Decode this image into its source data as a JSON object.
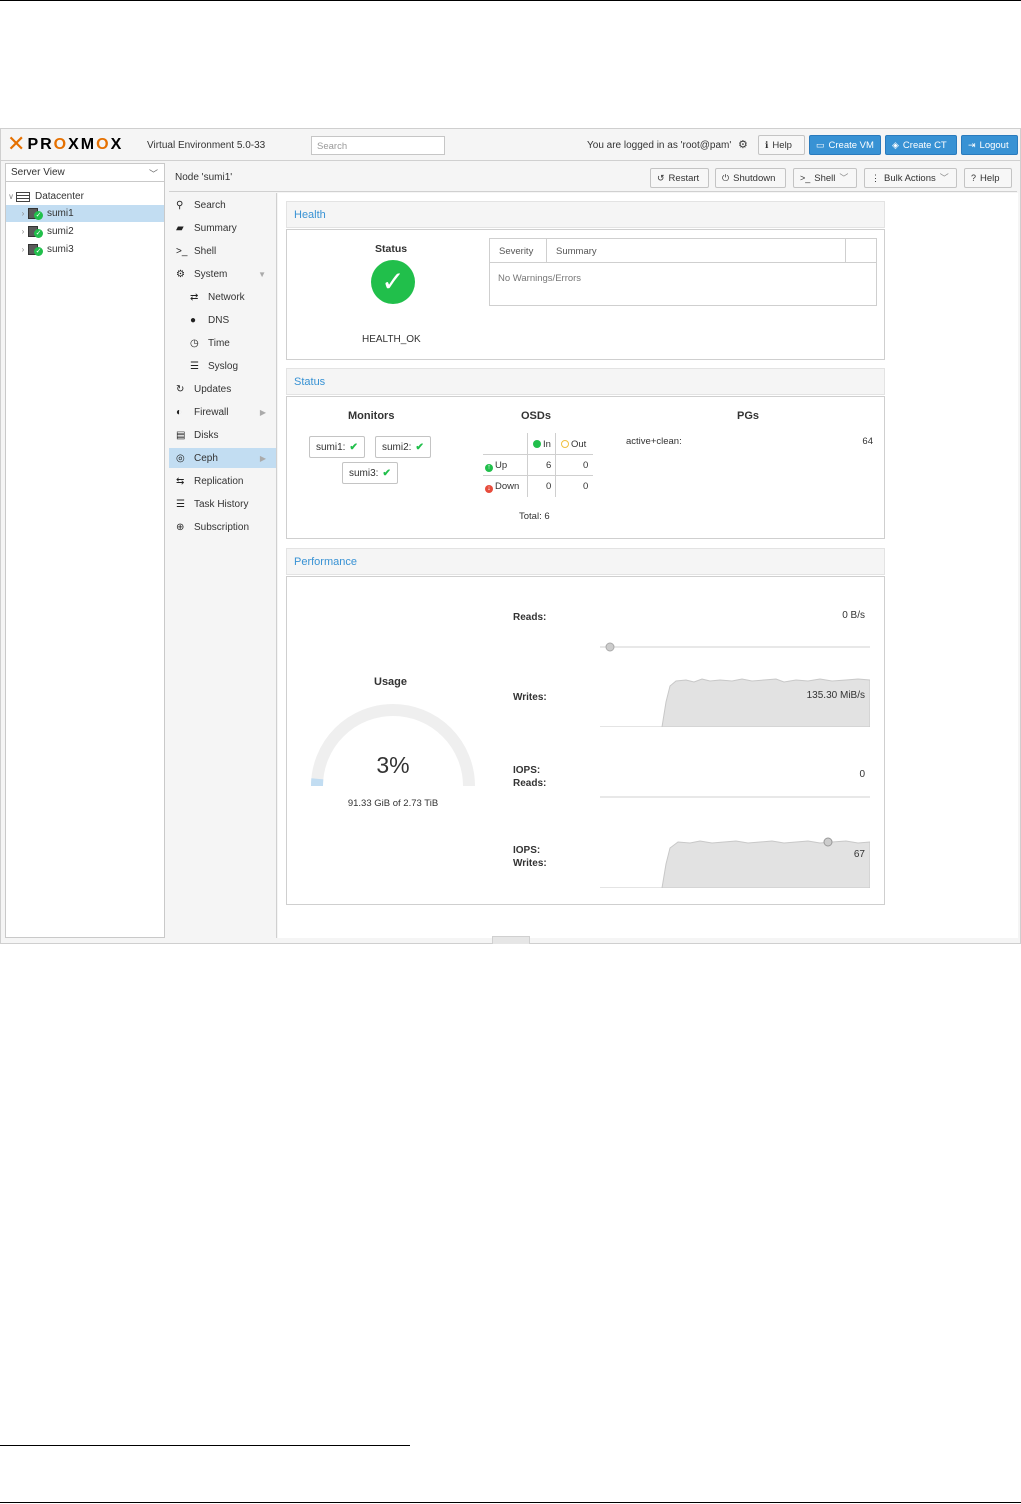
{
  "brand": {
    "logo_x": "✕",
    "logo_prefix": "PR",
    "logo_o1": "O",
    "logo_mid": "XM",
    "logo_o2": "O",
    "logo_suffix": "X",
    "version": "Virtual Environment 5.0-33",
    "accent": "#e57000"
  },
  "topbar": {
    "search_placeholder": "Search",
    "logged_in": "You are logged in as 'root@pam'",
    "help": "Help",
    "create_vm": "Create VM",
    "create_ct": "Create CT",
    "logout": "Logout"
  },
  "tree": {
    "view": "Server View",
    "datacenter": "Datacenter",
    "nodes": [
      "sumi1",
      "sumi2",
      "sumi3"
    ]
  },
  "node_toolbar": {
    "title": "Node 'sumi1'",
    "restart": "Restart",
    "shutdown": "Shutdown",
    "shell": "Shell",
    "bulk_actions": "Bulk Actions",
    "help": "Help"
  },
  "nav": {
    "search": "Search",
    "summary": "Summary",
    "shell": "Shell",
    "system": "System",
    "network": "Network",
    "dns": "DNS",
    "time": "Time",
    "syslog": "Syslog",
    "updates": "Updates",
    "firewall": "Firewall",
    "disks": "Disks",
    "ceph": "Ceph",
    "replication": "Replication",
    "task_history": "Task History",
    "subscription": "Subscription"
  },
  "health": {
    "title": "Health",
    "status_label": "Status",
    "status_value": "HEALTH_OK",
    "col_severity": "Severity",
    "col_summary": "Summary",
    "empty": "No Warnings/Errors"
  },
  "status": {
    "title": "Status",
    "monitors_label": "Monitors",
    "monitors": [
      "sumi1:",
      "sumi2:",
      "sumi3:"
    ],
    "osds_label": "OSDs",
    "osd_in": "In",
    "osd_out": "Out",
    "osd_up": "Up",
    "osd_down": "Down",
    "up_in": "6",
    "up_out": "0",
    "down_in": "0",
    "down_out": "0",
    "total": "Total: 6",
    "pgs_label": "PGs",
    "pg_state": "active+clean:",
    "pg_count": "64"
  },
  "performance": {
    "title": "Performance",
    "usage_label": "Usage",
    "usage_percent": "3%",
    "usage_fraction": 0.03,
    "usage_detail": "91.33 GiB of 2.73 TiB",
    "reads_label": "Reads:",
    "reads_value": "0 B/s",
    "writes_label": "Writes:",
    "writes_value": "135.30 MiB/s",
    "iops_reads_label1": "IOPS:",
    "iops_reads_label2": "Reads:",
    "iops_reads_value": "0",
    "iops_writes_label1": "IOPS:",
    "iops_writes_label2": "Writes:",
    "iops_writes_value": "67"
  },
  "colors": {
    "ok": "#21bf4b",
    "link": "#3892d4",
    "warn": "#f0ad4e",
    "err": "#e74c3c"
  }
}
